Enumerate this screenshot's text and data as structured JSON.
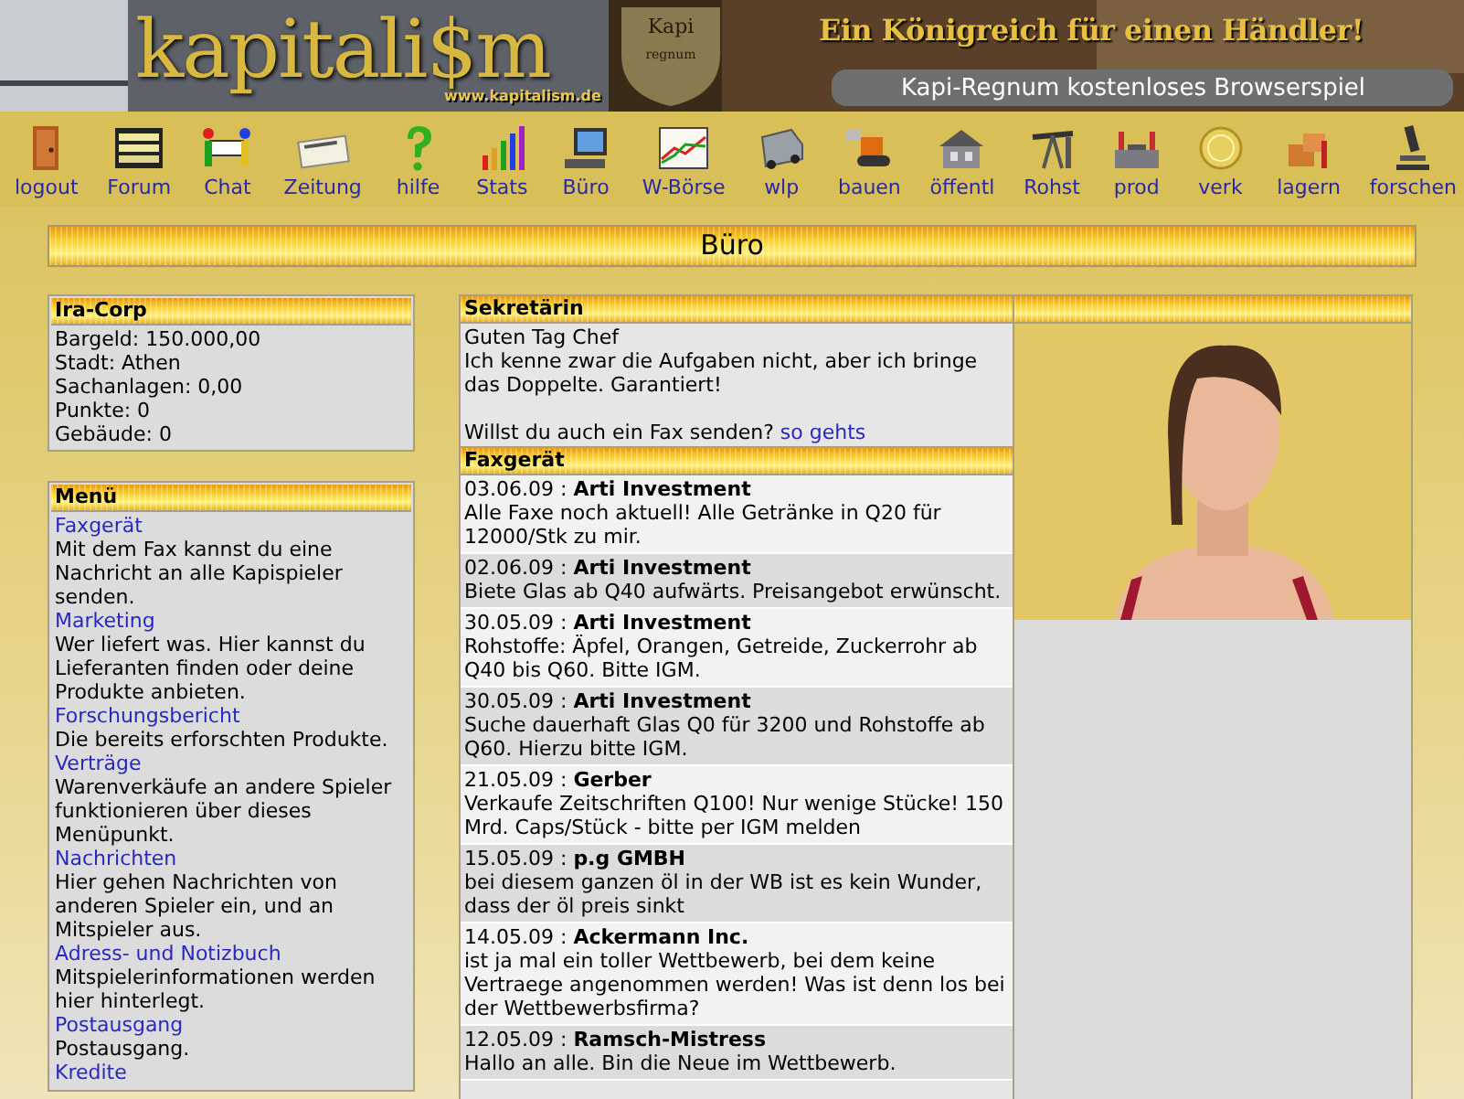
{
  "banner": {
    "logo": "kapitali$m",
    "url": "www.kapitalism.de",
    "shield_top": "Kapi",
    "shield_bottom": "regnum",
    "slogan": "Ein Königreich für einen Händler!",
    "subtitle": "Kapi-Regnum kostenloses Browserspiel"
  },
  "nav": [
    {
      "label": "logout"
    },
    {
      "label": "Forum"
    },
    {
      "label": "Chat"
    },
    {
      "label": "Zeitung"
    },
    {
      "label": "hilfe"
    },
    {
      "label": "Stats"
    },
    {
      "label": "Büro"
    },
    {
      "label": "W-Börse"
    },
    {
      "label": "wlp"
    },
    {
      "label": "bauen"
    },
    {
      "label": "öffentl"
    },
    {
      "label": "Rohst"
    },
    {
      "label": "prod"
    },
    {
      "label": "verk"
    },
    {
      "label": "lagern"
    },
    {
      "label": "forschen"
    }
  ],
  "page_title": "Büro",
  "company": {
    "title": "Ira-Corp",
    "lines": [
      "Bargeld: 150.000,00",
      "Stadt: Athen",
      "Sachanlagen: 0,00",
      "Punkte: 0",
      "Gebäude: 0"
    ]
  },
  "menu": {
    "title": "Menü",
    "items": [
      {
        "link": "Faxgerät",
        "description": "Mit dem Fax kannst du eine Nachricht an alle Kapispieler senden."
      },
      {
        "link": "Marketing",
        "description": "Wer liefert was. Hier kannst du Lieferanten finden oder deine Produkte anbieten."
      },
      {
        "link": "Forschungsbericht",
        "description": "Die bereits erforschten Produkte."
      },
      {
        "link": "Verträge",
        "description": "Warenverkäufe an andere Spieler funktionieren über dieses Menüpunkt."
      },
      {
        "link": "Nachrichten",
        "description": "Hier gehen Nachrichten von anderen Spieler ein, und an Mitspieler aus."
      },
      {
        "link": "Adress- und Notizbuch",
        "description": "Mitspielerinformationen werden hier hinterlegt."
      },
      {
        "link": "Postausgang",
        "description": "Postausgang."
      },
      {
        "link": "Kredite"
      }
    ]
  },
  "secretary": {
    "title": "Sekretärin",
    "greeting": "Guten Tag Chef",
    "message": "Ich kenne zwar die Aufgaben nicht, aber ich bringe das Doppelte. Garantiert!",
    "question": "Willst du auch ein Fax senden?",
    "link": "so gehts"
  },
  "fax": {
    "title": "Faxgerät",
    "messages": [
      {
        "header": "03.06.09 : **Arti Investment**",
        "text": "Alle Faxe noch aktuell! Alle Getränke in Q20 für 12000/Stk zu mir."
      },
      {
        "header": "02.06.09 : **Arti Investment**",
        "text": "Biete Glas ab Q40 aufwärts. Preisangebot erwünscht."
      },
      {
        "header": "30.05.09 : **Arti Investment**",
        "text": "Rohstoffe: Äpfel, Orangen, Getreide, Zuckerrohr ab Q40 bis Q60. Bitte IGM."
      },
      {
        "header": "30.05.09 : **Arti Investment**",
        "text": "Suche dauerhaft Glas Q0 für 3200 und Rohstoffe ab Q60. Hierzu bitte IGM."
      },
      {
        "header": "21.05.09 : **Gerber**",
        "text": "Verkaufe Zeitschriften Q100! Nur wenige Stücke! 150 Mrd. Caps/Stück - bitte per IGM melden"
      },
      {
        "header": "15.05.09 : **p.g GMBH**",
        "text": "bei diesem ganzen öl in der WB ist es kein Wunder, dass der öl preis sinkt"
      },
      {
        "header": "14.05.09 : **Ackermann Inc.**",
        "text": "ist ja mal ein toller Wettbewerb, bei dem keine Vertraege angenommen werden! Was ist denn los bei der Wettbewerbsfirma?"
      },
      {
        "header": "12.05.09 : **Ramsch-Mistress**",
        "text": "Hallo an alle. Bin die Neue im Wettbewerb."
      }
    ]
  }
}
